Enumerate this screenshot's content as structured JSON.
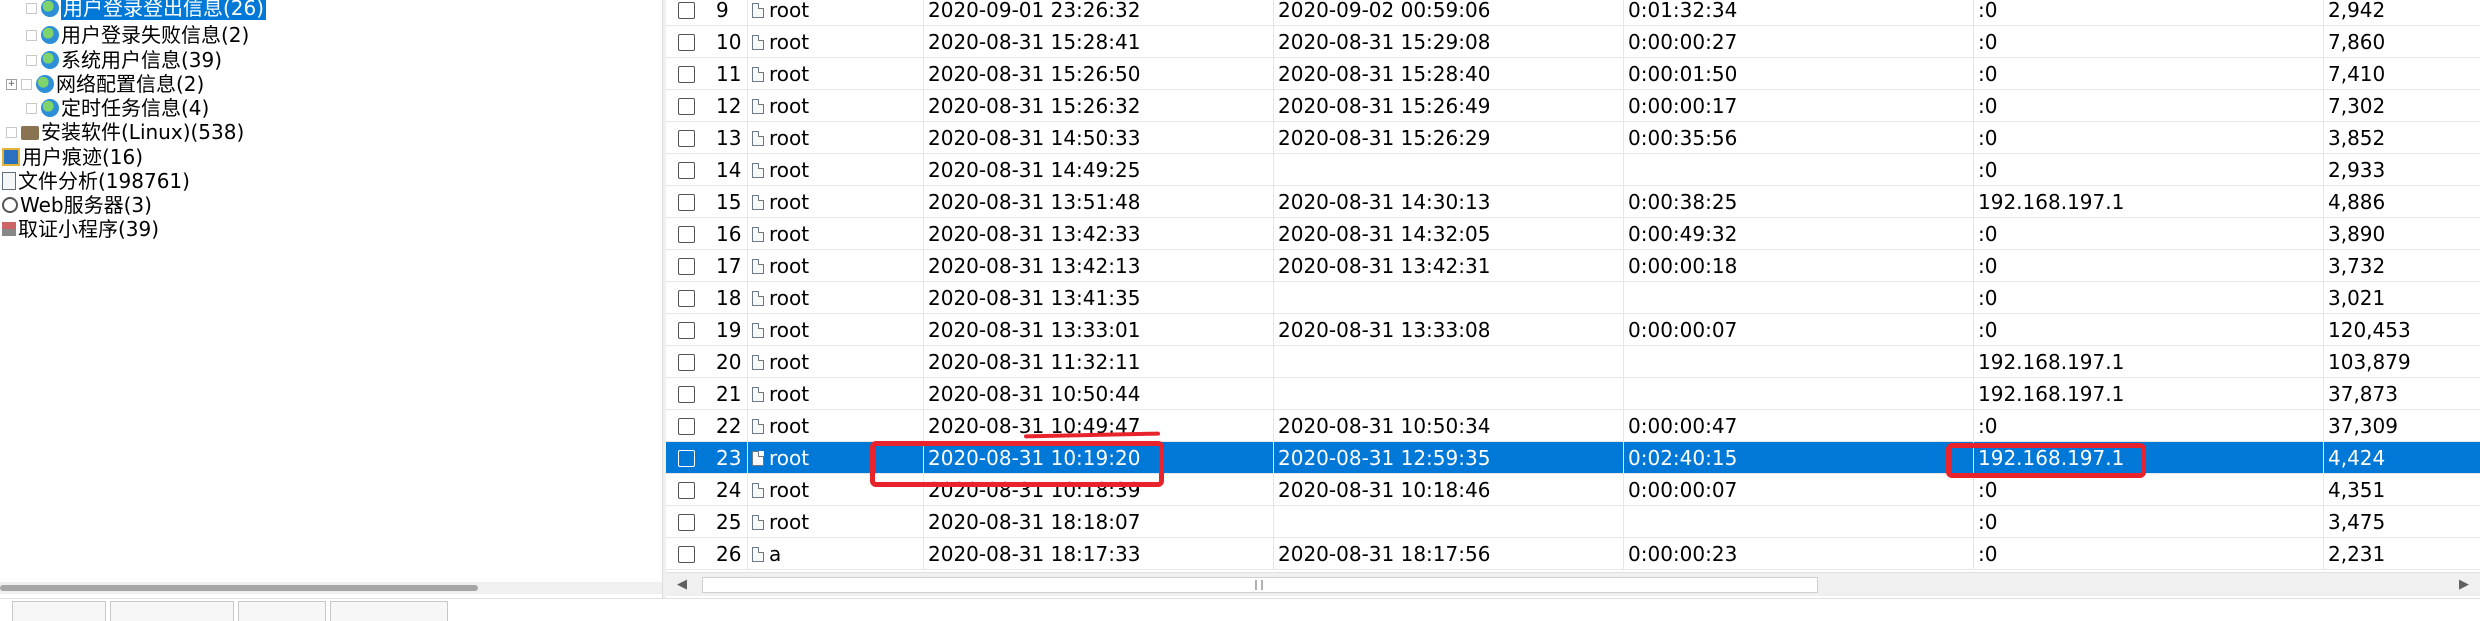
{
  "tree": {
    "nodes": [
      {
        "label": "用户登录登出信息(26)",
        "icon": "globe-icon",
        "selected": true
      },
      {
        "label": "用户登录失败信息(2)",
        "icon": "globe-icon",
        "selected": false
      },
      {
        "label": "系统用户信息(39)",
        "icon": "globe-icon",
        "selected": false
      },
      {
        "label": "网络配置信息(2)",
        "icon": "globe-icon",
        "selected": false
      },
      {
        "label": "定时任务信息(4)",
        "icon": "globe-icon",
        "selected": false
      },
      {
        "label": "安装软件(Linux)(538)",
        "icon": "package-icon",
        "selected": false
      },
      {
        "label": "用户痕迹(16)",
        "icon": "user-trace-icon",
        "selected": false
      },
      {
        "label": "文件分析(198761)",
        "icon": "file-analysis-icon",
        "selected": false
      },
      {
        "label": "Web服务器(3)",
        "icon": "web-server-icon",
        "selected": false
      },
      {
        "label": "取证小程序(39)",
        "icon": "applet-icon",
        "selected": false
      }
    ]
  },
  "grid": {
    "rows": [
      {
        "num": "9",
        "user": "root",
        "login": "2020-09-01 23:26:32",
        "logout": "2020-09-02 00:59:06",
        "duration": "0:01:32:34",
        "ip": ":0",
        "size": "2,942"
      },
      {
        "num": "10",
        "user": "root",
        "login": "2020-08-31 15:28:41",
        "logout": "2020-08-31 15:29:08",
        "duration": "0:00:00:27",
        "ip": ":0",
        "size": "7,860"
      },
      {
        "num": "11",
        "user": "root",
        "login": "2020-08-31 15:26:50",
        "logout": "2020-08-31 15:28:40",
        "duration": "0:00:01:50",
        "ip": ":0",
        "size": "7,410"
      },
      {
        "num": "12",
        "user": "root",
        "login": "2020-08-31 15:26:32",
        "logout": "2020-08-31 15:26:49",
        "duration": "0:00:00:17",
        "ip": ":0",
        "size": "7,302"
      },
      {
        "num": "13",
        "user": "root",
        "login": "2020-08-31 14:50:33",
        "logout": "2020-08-31 15:26:29",
        "duration": "0:00:35:56",
        "ip": ":0",
        "size": "3,852"
      },
      {
        "num": "14",
        "user": "root",
        "login": "2020-08-31 14:49:25",
        "logout": "",
        "duration": "",
        "ip": ":0",
        "size": "2,933"
      },
      {
        "num": "15",
        "user": "root",
        "login": "2020-08-31 13:51:48",
        "logout": "2020-08-31 14:30:13",
        "duration": "0:00:38:25",
        "ip": "192.168.197.1",
        "size": "4,886"
      },
      {
        "num": "16",
        "user": "root",
        "login": "2020-08-31 13:42:33",
        "logout": "2020-08-31 14:32:05",
        "duration": "0:00:49:32",
        "ip": ":0",
        "size": "3,890"
      },
      {
        "num": "17",
        "user": "root",
        "login": "2020-08-31 13:42:13",
        "logout": "2020-08-31 13:42:31",
        "duration": "0:00:00:18",
        "ip": ":0",
        "size": "3,732"
      },
      {
        "num": "18",
        "user": "root",
        "login": "2020-08-31 13:41:35",
        "logout": "",
        "duration": "",
        "ip": ":0",
        "size": "3,021"
      },
      {
        "num": "19",
        "user": "root",
        "login": "2020-08-31 13:33:01",
        "logout": "2020-08-31 13:33:08",
        "duration": "0:00:00:07",
        "ip": ":0",
        "size": "120,453"
      },
      {
        "num": "20",
        "user": "root",
        "login": "2020-08-31 11:32:11",
        "logout": "",
        "duration": "",
        "ip": "192.168.197.1",
        "size": "103,879"
      },
      {
        "num": "21",
        "user": "root",
        "login": "2020-08-31 10:50:44",
        "logout": "",
        "duration": "",
        "ip": "192.168.197.1",
        "size": "37,873"
      },
      {
        "num": "22",
        "user": "root",
        "login": "2020-08-31 10:49:47",
        "logout": "2020-08-31 10:50:34",
        "duration": "0:00:00:47",
        "ip": ":0",
        "size": "37,309"
      },
      {
        "num": "23",
        "user": "root",
        "login": "2020-08-31 10:19:20",
        "logout": "2020-08-31 12:59:35",
        "duration": "0:02:40:15",
        "ip": "192.168.197.1",
        "size": "4,424",
        "selected": true
      },
      {
        "num": "24",
        "user": "root",
        "login": "2020-08-31 10:18:39",
        "logout": "2020-08-31 10:18:46",
        "duration": "0:00:00:07",
        "ip": ":0",
        "size": "4,351"
      },
      {
        "num": "25",
        "user": "root",
        "login": "2020-08-31 18:18:07",
        "logout": "",
        "duration": "",
        "ip": ":0",
        "size": "3,475"
      },
      {
        "num": "26",
        "user": "a",
        "login": "2020-08-31 18:17:33",
        "logout": "2020-08-31 18:17:56",
        "duration": "0:00:00:23",
        "ip": ":0",
        "size": "2,231"
      }
    ]
  },
  "colors": {
    "selection": "#0078d7",
    "highlight": "#e8232b",
    "gridline": "#e6e6e6"
  }
}
